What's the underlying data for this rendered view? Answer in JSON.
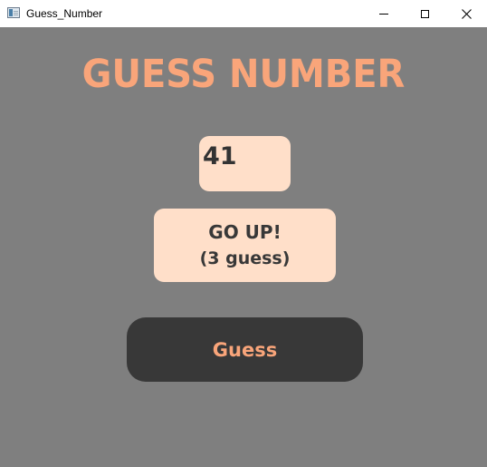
{
  "window": {
    "title": "Guess_Number",
    "icon": "app-window-icon",
    "controls": {
      "minimize_icon": "minimize-icon",
      "maximize_icon": "maximize-icon",
      "close_icon": "close-icon"
    }
  },
  "game": {
    "heading": "GUESS NUMBER",
    "number_input": {
      "value": "41"
    },
    "hint": {
      "line1": "GO UP!",
      "line2": "(3 guess)"
    },
    "guess_button_label": "Guess"
  },
  "colors": {
    "background": "#7f7f7f",
    "accent": "#f9a57a",
    "panel": "#ffdfc9",
    "dark": "#383838"
  }
}
